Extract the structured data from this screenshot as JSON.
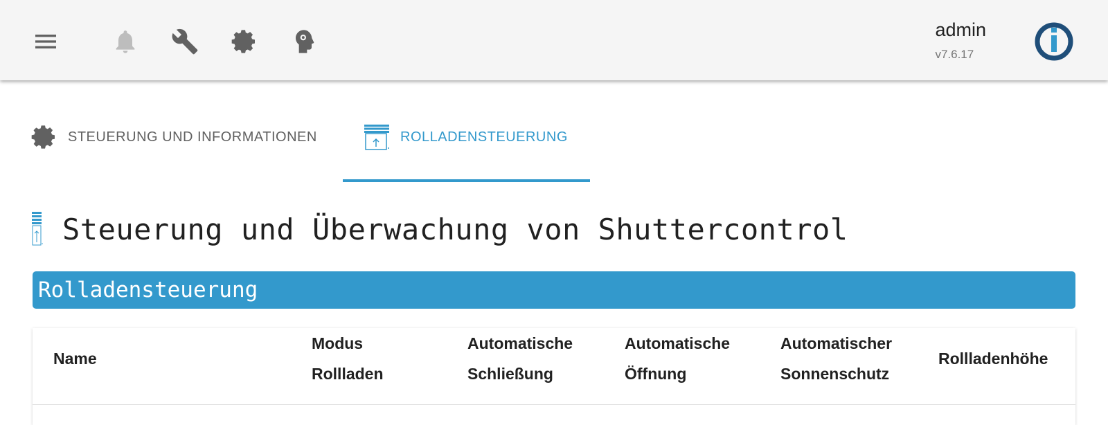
{
  "header": {
    "icons": [
      "menu-icon",
      "bell-icon",
      "wrench-icon",
      "gear-icon",
      "head-idea-icon"
    ],
    "user_name": "admin",
    "version": "v7.6.17"
  },
  "tabs": [
    {
      "label": "STEUERUNG UND INFORMATIONEN",
      "icon": "gear-icon",
      "active": false
    },
    {
      "label": "ROLLADENSTEUERUNG",
      "icon": "shutter-icon",
      "active": true
    }
  ],
  "page": {
    "title": "Steuerung und Überwachung von Shuttercontrol",
    "section": "Rolladensteuerung"
  },
  "table": {
    "columns": [
      [
        "Name"
      ],
      [
        "Modus",
        "Rollladen"
      ],
      [
        "Automatische",
        "Schließung"
      ],
      [
        "Automatische",
        "Öffnung"
      ],
      [
        "Automatischer",
        "Sonnenschutz"
      ],
      [
        "Rollladenhöhe"
      ]
    ]
  },
  "colors": {
    "accent": "#3399cc",
    "topbar": "#f5f5f5",
    "icon_gray": "#616161",
    "disabled_gray": "#bdbdbd"
  }
}
